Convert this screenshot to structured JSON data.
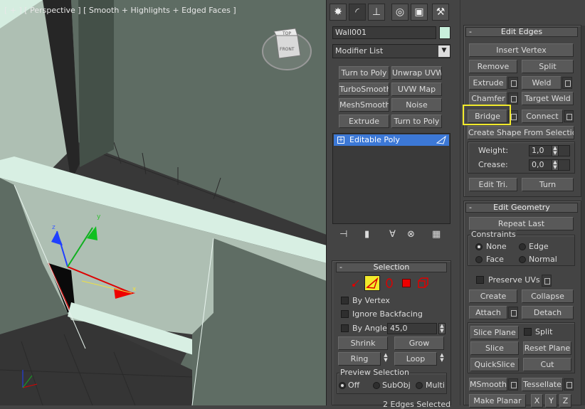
{
  "viewport": {
    "label": "[ + ] [ Perspective ] [ Smooth + Highlights + Edged Faces ]",
    "viewcube_top": "TOP",
    "viewcube_front": "FRONT",
    "axis_x": "x",
    "axis_y": "y",
    "axis_z": "z"
  },
  "command_panel": {
    "tabs": [
      {
        "icon": "create-icon",
        "glyph": "✸"
      },
      {
        "icon": "modify-icon",
        "glyph": "◜"
      },
      {
        "icon": "hierarchy-icon",
        "glyph": "⊥"
      },
      {
        "icon": "motion-icon",
        "glyph": "◎"
      },
      {
        "icon": "display-icon",
        "glyph": "▣"
      },
      {
        "icon": "utilities-icon",
        "glyph": "⚒"
      }
    ],
    "object_name": "Wall001",
    "object_color": "#c8f0dc",
    "modifier_list_label": "Modifier List",
    "modifier_buttons": [
      "Turn to Poly",
      "Unwrap UVW",
      "TurboSmooth",
      "UVW Map",
      "MeshSmooth",
      "Noise",
      "Extrude",
      "Turn to Poly"
    ],
    "stack_item": "Editable Poly",
    "stack_expand": "+"
  },
  "selection": {
    "title": "Selection",
    "collapse": "-",
    "by_vertex": "By Vertex",
    "ignore_backfacing": "Ignore Backfacing",
    "by_angle": "By Angle:",
    "by_angle_value": "45,0",
    "shrink": "Shrink",
    "grow": "Grow",
    "ring": "Ring",
    "loop": "Loop",
    "preview_selection": "Preview Selection",
    "preview_off": "Off",
    "preview_subobj": "SubObj",
    "preview_multi": "Multi",
    "status": "2 Edges Selected"
  },
  "edit_edges": {
    "title": "Edit Edges",
    "collapse": "-",
    "insert_vertex": "Insert Vertex",
    "remove": "Remove",
    "split": "Split",
    "extrude": "Extrude",
    "weld": "Weld",
    "chamfer": "Chamfer",
    "target_weld": "Target Weld",
    "bridge": "Bridge",
    "connect": "Connect",
    "create_shape": "Create Shape From Selection",
    "weight_label": "Weight:",
    "weight_value": "1,0",
    "crease_label": "Crease:",
    "crease_value": "0,0",
    "edit_tri": "Edit Tri.",
    "turn": "Turn"
  },
  "edit_geometry": {
    "title": "Edit Geometry",
    "collapse": "-",
    "repeat_last": "Repeat Last",
    "constraints": "Constraints",
    "none": "None",
    "edge": "Edge",
    "face": "Face",
    "normal": "Normal",
    "preserve_uvs": "Preserve UVs",
    "create": "Create",
    "collapse_btn": "Collapse",
    "attach": "Attach",
    "detach": "Detach",
    "slice_plane": "Slice Plane",
    "split": "Split",
    "slice": "Slice",
    "reset_plane": "Reset Plane",
    "quickslice": "QuickSlice",
    "cut": "Cut",
    "msmooth": "MSmooth",
    "tessellate": "Tessellate",
    "make_planar": "Make Planar",
    "x": "X",
    "y": "Y",
    "z": "Z"
  },
  "colors": {
    "highlight": "#f2ea2b",
    "stack_selected": "#3c78d6",
    "wall_face": "#aebfb3",
    "wall_top": "#d8efe3",
    "floor": "#3a3a3a"
  }
}
